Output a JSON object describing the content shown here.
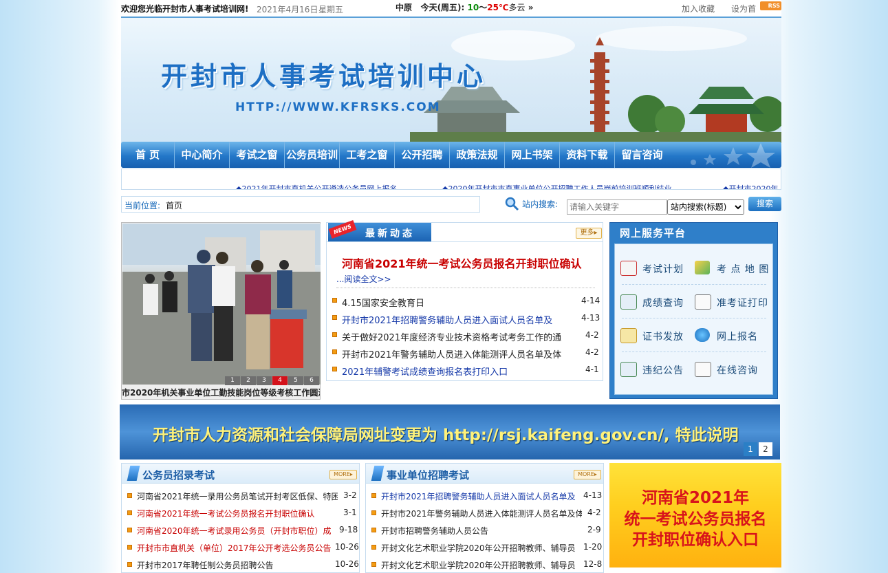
{
  "topbar": {
    "welcome": "欢迎您光临开封市人事考试培训网!",
    "date": "2021年4月16日",
    "weekday": "星期五",
    "weather_city": "中原",
    "weather_today": "今天(周五):",
    "weather_low": "10",
    "weather_sep": "～",
    "weather_high": "25℃",
    "weather_desc": "多云",
    "weather_more": "»",
    "add_favorite": "加入收藏",
    "set_home": "设为首",
    "rss": "RSS"
  },
  "banner": {
    "title": "开封市人事考试培训中心",
    "url": "HTTP://WWW.KFRSKS.COM"
  },
  "nav": {
    "items": [
      {
        "label": "首 页"
      },
      {
        "label": "中心简介"
      },
      {
        "label": "考试之窗"
      },
      {
        "label": "公务员培训"
      },
      {
        "label": "工考之窗"
      },
      {
        "label": "公开招聘"
      },
      {
        "label": "政策法规"
      },
      {
        "label": "网上书架"
      },
      {
        "label": "资料下载"
      },
      {
        "label": "留言咨询"
      }
    ]
  },
  "ticker": {
    "items": [
      "◆2021年开封市直机关公开遴选公务员网上报名",
      "◆2020年开封市市直事业单位公开招聘工作人员岗前培训班顺利结业",
      "◆开封市2020年"
    ]
  },
  "location": {
    "label": "当前位置:",
    "value": "首页"
  },
  "search": {
    "label": "站内搜索:",
    "placeholder": "请输入关键字",
    "select_value": "站内搜索(标题)",
    "button": "搜索"
  },
  "slideshow": {
    "caption": "市2020年机关事业单位工勤技能岗位等级考核工作圆满",
    "pages": [
      "1",
      "2",
      "3",
      "4",
      "5",
      "6"
    ],
    "active_page": "4"
  },
  "news": {
    "tag": "NEWS",
    "title": "最新动态",
    "more": "更多▸",
    "headline": "河南省2021年统一考试公务员报名开封职位确认",
    "read_more": "...阅读全文>>",
    "items": [
      {
        "text": "4.15国家安全教育日",
        "date": "4-14",
        "color": "#222222"
      },
      {
        "text": "开封市2021年招聘警务辅助人员进入面试人员名单及",
        "date": "4-13",
        "color": "#1438a8"
      },
      {
        "text": "关于做好2021年度经济专业技术资格考试考务工作的通",
        "date": "4-2",
        "color": "#222222"
      },
      {
        "text": "开封市2021年警务辅助人员进入体能测评人员名单及体",
        "date": "4-2",
        "color": "#222222"
      },
      {
        "text": "2021年辅警考试成绩查询报名表打印入口",
        "date": "4-1",
        "color": "#1438a8"
      }
    ]
  },
  "service": {
    "title": "网上服务平台",
    "items": [
      {
        "label": "考试计划",
        "icon": "calendar-icon"
      },
      {
        "label": "考 点 地 图",
        "icon": "map-icon"
      },
      {
        "label": "成绩查询",
        "icon": "score-icon"
      },
      {
        "label": "准考证打印",
        "icon": "envelope-icon"
      },
      {
        "label": "证书发放",
        "icon": "certificate-icon"
      },
      {
        "label": "网上报名",
        "icon": "signup-icon"
      },
      {
        "label": "违纪公告",
        "icon": "notice-icon"
      },
      {
        "label": "在线咨询",
        "icon": "mail-icon"
      }
    ]
  },
  "wide_banner": {
    "text": "开封市人力资源和社会保障局网址变更为 http://rsj.kaifeng.gov.cn/, 特此说明",
    "pages": [
      "1",
      "2"
    ],
    "active_page": "1"
  },
  "civil_service": {
    "title": "公务员招录考试",
    "more": "MORE▸",
    "items": [
      {
        "text": "河南省2021年统一录用公务员笔试开封考区低保、特困",
        "date": "3-2",
        "color": "#222222"
      },
      {
        "text": "河南省2021年统一考试公务员报名开封职位确认",
        "date": "3-1",
        "color": "#c80000"
      },
      {
        "text": "河南省2020年统一考试录用公务员（开封市职位）成",
        "date": "9-18",
        "color": "#c80000"
      },
      {
        "text": "开封市市直机关（单位）2017年公开考选公务员公告",
        "date": "10-26",
        "color": "#c80000"
      },
      {
        "text": "开封市2017年聘任制公务员招聘公告",
        "date": "10-26",
        "color": "#222222"
      }
    ]
  },
  "institution": {
    "title": "事业单位招聘考试",
    "more": "MORE▸",
    "items": [
      {
        "text": "开封市2021年招聘警务辅助人员进入面试人员名单及",
        "date": "4-13",
        "color": "#1438a8"
      },
      {
        "text": "开封市2021年警务辅助人员进入体能测评人员名单及体",
        "date": "4-2",
        "color": "#222222"
      },
      {
        "text": "开封市招聘警务辅助人员公告",
        "date": "2-9",
        "color": "#222222"
      },
      {
        "text": "开封文化艺术职业学院2020年公开招聘教师、辅导员",
        "date": "1-20",
        "color": "#222222"
      },
      {
        "text": "开封文化艺术职业学院2020年公开招聘教师、辅导员",
        "date": "12-8",
        "color": "#222222"
      }
    ]
  },
  "ad": {
    "lines": [
      "河南省2021年",
      "统一考试公务员报名",
      "开封职位确认入口"
    ]
  }
}
